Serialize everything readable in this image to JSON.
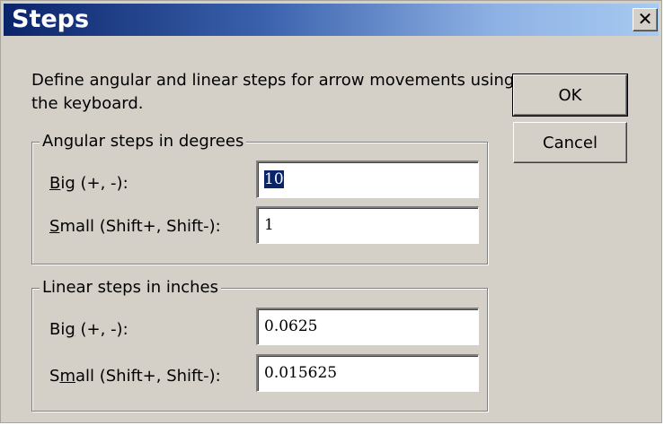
{
  "dialog": {
    "title": "Steps",
    "close_label": "✕",
    "description": "Define angular and linear steps for arrow movements using the keyboard."
  },
  "buttons": {
    "ok_label": "OK",
    "cancel_label": "Cancel"
  },
  "angular": {
    "group_title": "Angular steps in degrees",
    "big": {
      "label_pre": "",
      "label_accel": "B",
      "label_post": "ig (+, -):",
      "value": "10"
    },
    "small": {
      "label_pre": "",
      "label_accel": "S",
      "label_post": "mall (Shift+, Shift-):",
      "value": "1"
    }
  },
  "linear": {
    "group_title": "Linear steps in inches",
    "big": {
      "label_pre": "Bi",
      "label_accel": "g",
      "label_post": " (+, -):",
      "value": "0.0625"
    },
    "small": {
      "label_pre": "S",
      "label_accel": "m",
      "label_post": "all (Shift+, Shift-):",
      "value": "0.015625"
    }
  },
  "colors": {
    "titlebar_start": "#0a246a",
    "titlebar_end": "#a6caf0",
    "dialog_face": "#d4d0c8",
    "selection": "#0a246a"
  }
}
